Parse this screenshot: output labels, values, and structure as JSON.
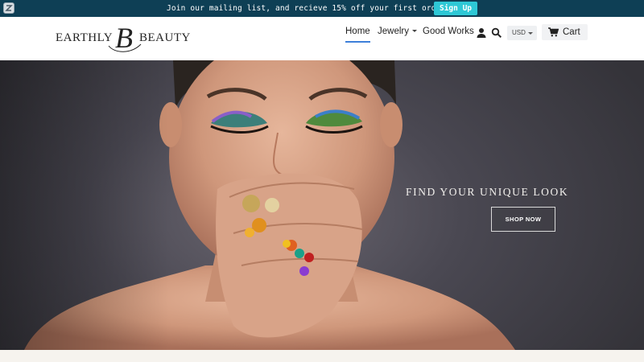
{
  "announcement": {
    "message": "Join our mailing list, and recieve 15% off your first order!",
    "button_label": "Sign Up",
    "colors": {
      "bar": "#0e3f55",
      "button": "#2ec8d6"
    }
  },
  "header": {
    "logo": {
      "left_word": "EARTHLY",
      "right_word": "BEAUTY",
      "monogram": "B"
    },
    "nav": [
      {
        "label": "Home",
        "active": true
      },
      {
        "label": "Jewelry",
        "has_dropdown": true
      },
      {
        "label": "Good Works"
      }
    ],
    "icons": [
      "user-icon",
      "search-icon",
      "cart-icon",
      "chevron-down-icon"
    ],
    "currency": "USD",
    "cart_label": "Cart",
    "accent_color": "#3d7fd9"
  },
  "hero": {
    "headline": "FIND YOUR UNIQUE LOOK",
    "button_label": "SHOP NOW"
  }
}
